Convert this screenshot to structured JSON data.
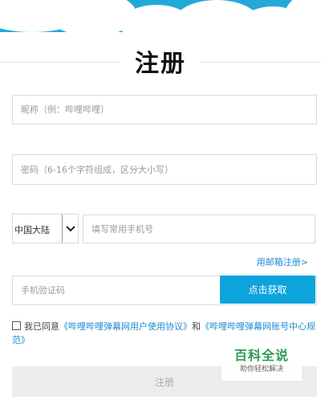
{
  "page": {
    "title": "注册"
  },
  "form": {
    "nickname_placeholder": "昵称（例：哔哩哔哩）",
    "password_placeholder": "密码（6-16个字符组成，区分大小写）",
    "region_label": "中国大陆",
    "phone_placeholder": "填写常用手机号",
    "email_register_link": "用邮箱注册>",
    "sms_code_placeholder": "手机验证码",
    "sms_button_label": "点击获取",
    "agree_prefix": "我已同意",
    "agreement_link_1": "《哔哩哔哩弹幕网用户使用协议》",
    "agree_and": "和",
    "agreement_link_2": "《哔哩哔哩弹幕网账号中心规范》",
    "submit_label": "注册"
  },
  "watermark": {
    "title": "百科全说",
    "subtitle": "助你轻松解决"
  },
  "colors": {
    "header_sky": "#23a9d9",
    "accent_button": "#0da4dd",
    "link": "#1e8bd0",
    "disabled_button": "#ececec",
    "watermark_green": "#2e9a52"
  }
}
